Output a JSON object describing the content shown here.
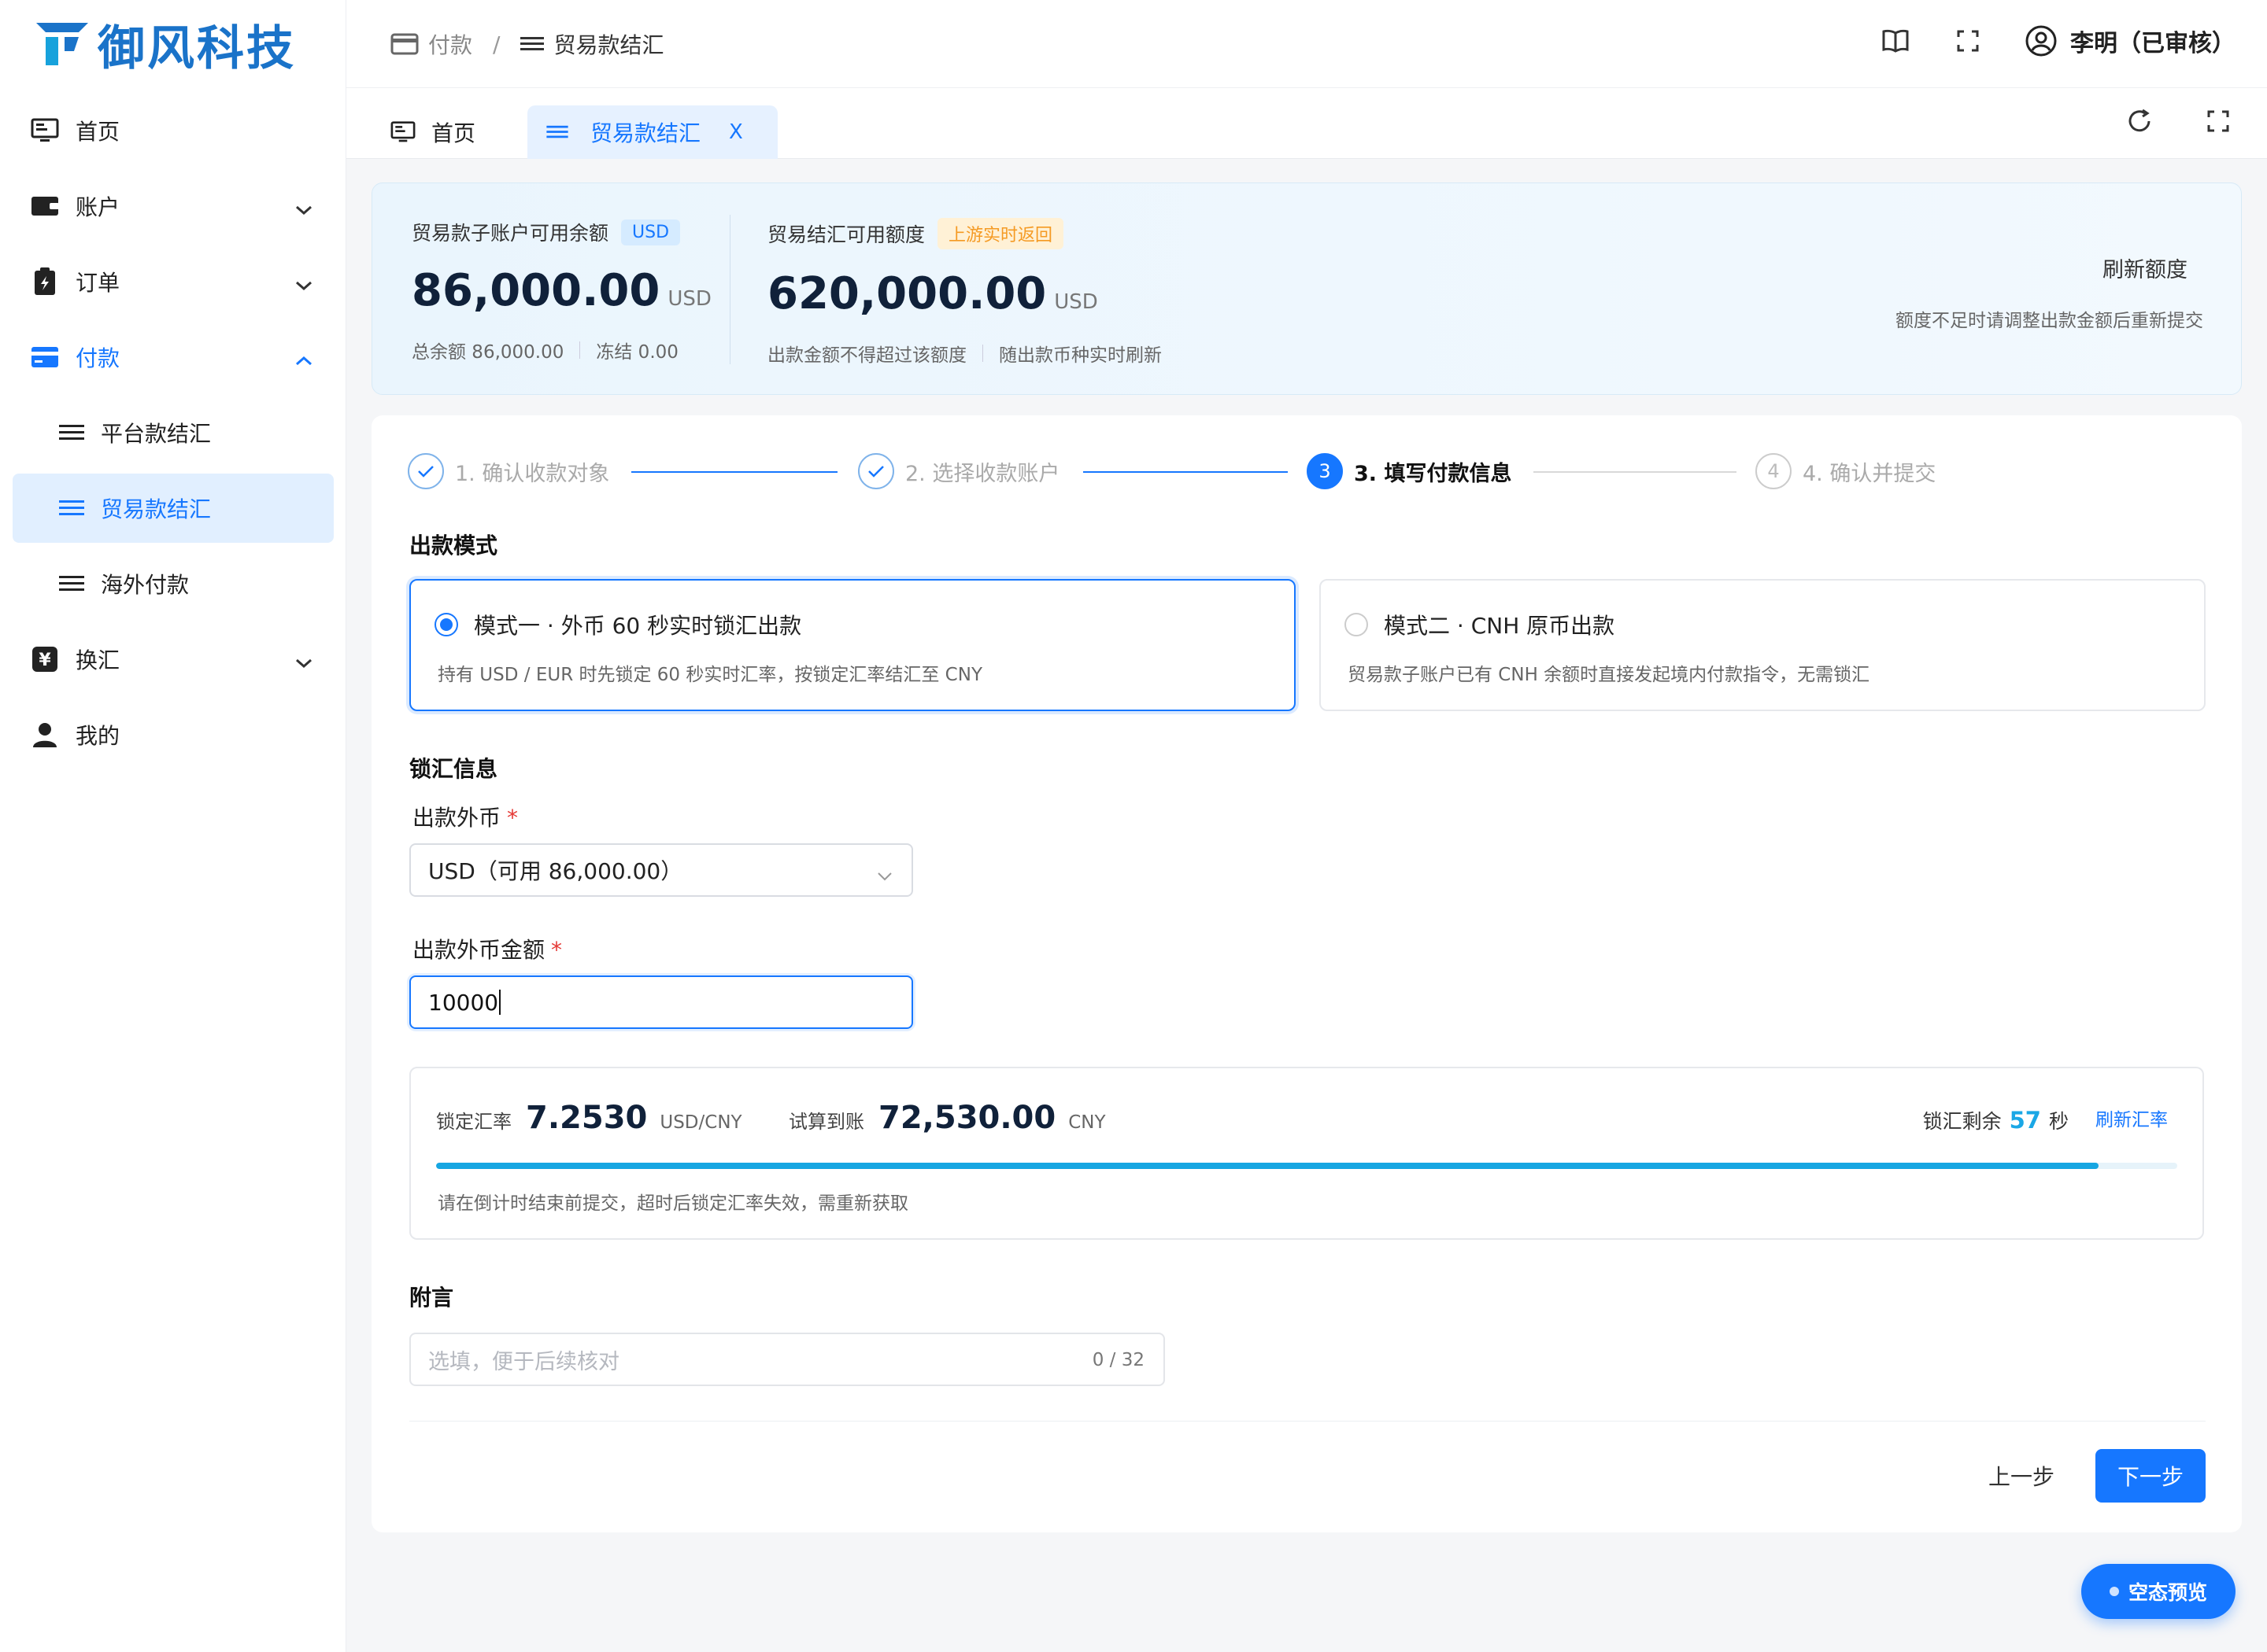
{
  "brand": {
    "name": "御风科技",
    "color": "#1a73c9"
  },
  "sidebar": {
    "items": [
      {
        "label": "首页",
        "icon": "monitor-icon"
      },
      {
        "label": "账户",
        "icon": "wallet-icon"
      },
      {
        "label": "订单",
        "icon": "order-icon"
      },
      {
        "label": "付款",
        "icon": "card-icon"
      },
      {
        "label": "平台款结汇",
        "icon": "list-icon"
      },
      {
        "label": "贸易款结汇",
        "icon": "list-icon"
      },
      {
        "label": "海外付款",
        "icon": "list-icon"
      },
      {
        "label": "换汇",
        "icon": "yen-icon"
      },
      {
        "label": "我的",
        "icon": "user-icon"
      }
    ]
  },
  "topbar": {
    "breadcrumb": [
      "付款",
      "贸易款结汇"
    ],
    "separator": "/",
    "user": "李明（已审核）"
  },
  "tabs": [
    {
      "label": "首页"
    },
    {
      "label": "贸易款结汇",
      "close": "X"
    }
  ],
  "balance": {
    "sub_label": "贸易款子账户可用余额",
    "sub_tag": "USD",
    "sub_amount": "86,000.00",
    "sub_unit": "USD",
    "total": "总余额 86,000.00",
    "frozen": "冻结 0.00",
    "quota_label": "贸易结汇可用额度",
    "quota_tag": "上游实时返回",
    "quota_amount": "620,000.00",
    "quota_unit": "USD",
    "quota_note1": "出款金额不得超过该额度",
    "quota_note2": "随出款币种实时刷新",
    "refresh_title": "刷新额度",
    "refresh_desc": "额度不足时请调整出款金额后重新提交"
  },
  "steps": [
    {
      "label": "1. 确认收款对象",
      "state": "done"
    },
    {
      "label": "2. 选择收款账户",
      "state": "done"
    },
    {
      "label": "3. 填写付款信息",
      "num": "3",
      "state": "current"
    },
    {
      "label": "4. 确认并提交",
      "num": "4",
      "state": "todo"
    }
  ],
  "form": {
    "mode_title": "出款模式",
    "mode1_title": "模式一 · 外币 60 秒实时锁汇出款",
    "mode1_desc": "持有 USD / EUR 时先锁定 60 秒实时汇率，按锁定汇率结汇至 CNY",
    "mode2_title": "模式二 · CNH 原币出款",
    "mode2_desc": "贸易款子账户已有 CNH 余额时直接发起境内付款指令，无需锁汇",
    "lock_title": "锁汇信息",
    "currency_label": "出款外币",
    "currency_value": "USD（可用 86,000.00）",
    "amount_label": "出款外币金额",
    "amount_value": "10000",
    "required_mark": "*",
    "rate_label": "锁定汇率",
    "rate_value": "7.2530",
    "rate_unit": "USD/CNY",
    "est_label": "试算到账",
    "est_value": "72,530.00",
    "est_unit": "CNY",
    "countdown_label": "锁汇剩余",
    "countdown_value": "57",
    "countdown_unit": "秒",
    "countdown_progress": 0.955,
    "refresh_rate": "刷新汇率",
    "lock_note": "请在倒计时结束前提交，超时后锁定汇率失效，需重新获取",
    "memo_title": "附言",
    "memo_placeholder": "选填，便于后续核对",
    "memo_count": "0 / 32"
  },
  "buttons": {
    "prev": "上一步",
    "next": "下一步"
  },
  "float_btn": "空态预览",
  "colors": {
    "primary": "#1677ff",
    "accent_cyan": "#16a6e2",
    "orange": "#f59a23"
  }
}
